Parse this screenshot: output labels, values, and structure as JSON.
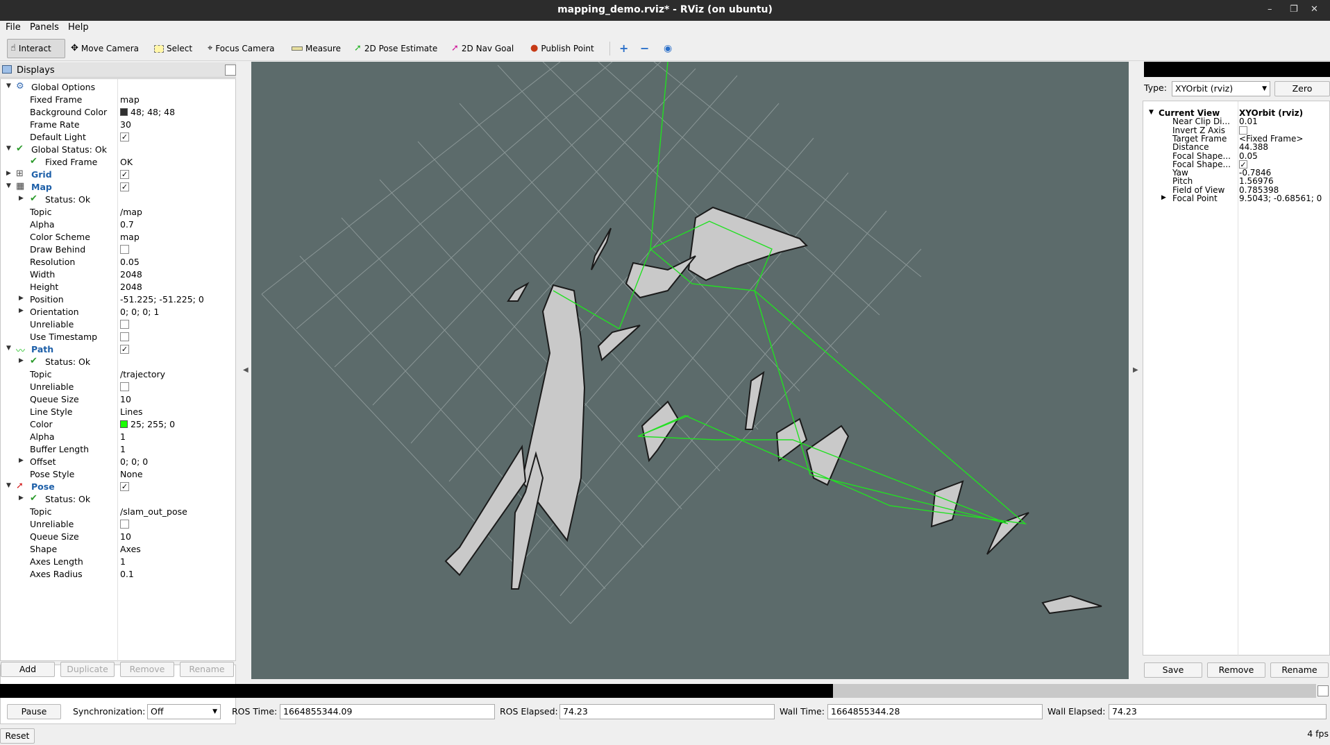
{
  "window": {
    "title": "mapping_demo.rviz* - RViz (on ubuntu)"
  },
  "menu": [
    "File",
    "Panels",
    "Help"
  ],
  "toolbar": {
    "tools": [
      "Interact",
      "Move Camera",
      "Select",
      "Focus Camera",
      "Measure",
      "2D Pose Estimate",
      "2D Nav Goal",
      "Publish Point"
    ],
    "icons": [
      "plus-icon",
      "minus-icon",
      "eye-icon"
    ]
  },
  "displays": {
    "title": "Displays",
    "rows": [
      {
        "name": "Global Options",
        "value": ""
      },
      {
        "name": "Fixed Frame",
        "value": "map"
      },
      {
        "name": "Background Color",
        "value": "48; 48; 48"
      },
      {
        "name": "Frame Rate",
        "value": "30"
      },
      {
        "name": "Default Light",
        "value": ""
      },
      {
        "name": "Global Status: Ok",
        "value": ""
      },
      {
        "name": "Fixed Frame",
        "value": "OK"
      },
      {
        "name": "Grid",
        "value": ""
      },
      {
        "name": "Map",
        "value": ""
      },
      {
        "name": "Status: Ok",
        "value": ""
      },
      {
        "name": "Topic",
        "value": "/map"
      },
      {
        "name": "Alpha",
        "value": "0.7"
      },
      {
        "name": "Color Scheme",
        "value": "map"
      },
      {
        "name": "Draw Behind",
        "value": ""
      },
      {
        "name": "Resolution",
        "value": "0.05"
      },
      {
        "name": "Width",
        "value": "2048"
      },
      {
        "name": "Height",
        "value": "2048"
      },
      {
        "name": "Position",
        "value": "-51.225; -51.225; 0"
      },
      {
        "name": "Orientation",
        "value": "0; 0; 0; 1"
      },
      {
        "name": "Unreliable",
        "value": ""
      },
      {
        "name": "Use Timestamp",
        "value": ""
      },
      {
        "name": "Path",
        "value": ""
      },
      {
        "name": "Status: Ok",
        "value": ""
      },
      {
        "name": "Topic",
        "value": "/trajectory"
      },
      {
        "name": "Unreliable",
        "value": ""
      },
      {
        "name": "Queue Size",
        "value": "10"
      },
      {
        "name": "Line Style",
        "value": "Lines"
      },
      {
        "name": "Color",
        "value": "25; 255; 0"
      },
      {
        "name": "Alpha",
        "value": "1"
      },
      {
        "name": "Buffer Length",
        "value": "1"
      },
      {
        "name": "Offset",
        "value": "0; 0; 0"
      },
      {
        "name": "Pose Style",
        "value": "None"
      },
      {
        "name": "Pose",
        "value": ""
      },
      {
        "name": "Status: Ok",
        "value": ""
      },
      {
        "name": "Topic",
        "value": "/slam_out_pose"
      },
      {
        "name": "Unreliable",
        "value": ""
      },
      {
        "name": "Queue Size",
        "value": "10"
      },
      {
        "name": "Shape",
        "value": "Axes"
      },
      {
        "name": "Axes Length",
        "value": "1"
      },
      {
        "name": "Axes Radius",
        "value": "0.1"
      }
    ],
    "colors": {
      "background": "#303030",
      "path": "#19ff00"
    },
    "buttons": [
      "Add",
      "Duplicate",
      "Remove",
      "Rename"
    ]
  },
  "views": {
    "type_label": "Type:",
    "type_value": "XYOrbit (rviz)",
    "zero": "Zero",
    "rows": [
      {
        "name": "Current View",
        "value": "XYOrbit (rviz)"
      },
      {
        "name": "Near Clip Di...",
        "value": "0.01"
      },
      {
        "name": "Invert Z Axis",
        "value": ""
      },
      {
        "name": "Target Frame",
        "value": "<Fixed Frame>"
      },
      {
        "name": "Distance",
        "value": "44.388"
      },
      {
        "name": "Focal Shape...",
        "value": "0.05"
      },
      {
        "name": "Focal Shape...",
        "value": ""
      },
      {
        "name": "Yaw",
        "value": "-0.7846"
      },
      {
        "name": "Pitch",
        "value": "1.56976"
      },
      {
        "name": "Field of View",
        "value": "0.785398"
      },
      {
        "name": "Focal Point",
        "value": "9.5043; -0.68561; 0"
      }
    ],
    "buttons": [
      "Save",
      "Remove",
      "Rename"
    ]
  },
  "time": {
    "pause": "Pause",
    "sync_label": "Synchronization:",
    "sync_value": "Off",
    "ros_time_label": "ROS Time:",
    "ros_time": "1664855344.09",
    "ros_elapsed_label": "ROS Elapsed:",
    "ros_elapsed": "74.23",
    "wall_time_label": "Wall Time:",
    "wall_time": "1664855344.28",
    "wall_elapsed_label": "Wall Elapsed:",
    "wall_elapsed": "74.23",
    "reset": "Reset",
    "fps": "4 fps"
  }
}
